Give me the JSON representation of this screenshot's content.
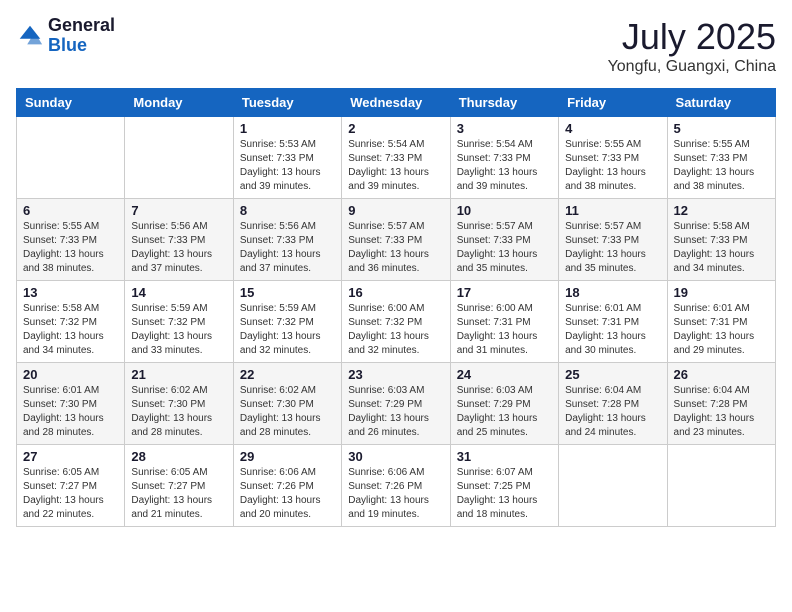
{
  "header": {
    "logo": {
      "general": "General",
      "blue": "Blue"
    },
    "title": "July 2025",
    "location": "Yongfu, Guangxi, China"
  },
  "calendar": {
    "days_of_week": [
      "Sunday",
      "Monday",
      "Tuesday",
      "Wednesday",
      "Thursday",
      "Friday",
      "Saturday"
    ],
    "weeks": [
      [
        {
          "day": "",
          "info": ""
        },
        {
          "day": "",
          "info": ""
        },
        {
          "day": "1",
          "info": "Sunrise: 5:53 AM\nSunset: 7:33 PM\nDaylight: 13 hours and 39 minutes."
        },
        {
          "day": "2",
          "info": "Sunrise: 5:54 AM\nSunset: 7:33 PM\nDaylight: 13 hours and 39 minutes."
        },
        {
          "day": "3",
          "info": "Sunrise: 5:54 AM\nSunset: 7:33 PM\nDaylight: 13 hours and 39 minutes."
        },
        {
          "day": "4",
          "info": "Sunrise: 5:55 AM\nSunset: 7:33 PM\nDaylight: 13 hours and 38 minutes."
        },
        {
          "day": "5",
          "info": "Sunrise: 5:55 AM\nSunset: 7:33 PM\nDaylight: 13 hours and 38 minutes."
        }
      ],
      [
        {
          "day": "6",
          "info": "Sunrise: 5:55 AM\nSunset: 7:33 PM\nDaylight: 13 hours and 38 minutes."
        },
        {
          "day": "7",
          "info": "Sunrise: 5:56 AM\nSunset: 7:33 PM\nDaylight: 13 hours and 37 minutes."
        },
        {
          "day": "8",
          "info": "Sunrise: 5:56 AM\nSunset: 7:33 PM\nDaylight: 13 hours and 37 minutes."
        },
        {
          "day": "9",
          "info": "Sunrise: 5:57 AM\nSunset: 7:33 PM\nDaylight: 13 hours and 36 minutes."
        },
        {
          "day": "10",
          "info": "Sunrise: 5:57 AM\nSunset: 7:33 PM\nDaylight: 13 hours and 35 minutes."
        },
        {
          "day": "11",
          "info": "Sunrise: 5:57 AM\nSunset: 7:33 PM\nDaylight: 13 hours and 35 minutes."
        },
        {
          "day": "12",
          "info": "Sunrise: 5:58 AM\nSunset: 7:33 PM\nDaylight: 13 hours and 34 minutes."
        }
      ],
      [
        {
          "day": "13",
          "info": "Sunrise: 5:58 AM\nSunset: 7:32 PM\nDaylight: 13 hours and 34 minutes."
        },
        {
          "day": "14",
          "info": "Sunrise: 5:59 AM\nSunset: 7:32 PM\nDaylight: 13 hours and 33 minutes."
        },
        {
          "day": "15",
          "info": "Sunrise: 5:59 AM\nSunset: 7:32 PM\nDaylight: 13 hours and 32 minutes."
        },
        {
          "day": "16",
          "info": "Sunrise: 6:00 AM\nSunset: 7:32 PM\nDaylight: 13 hours and 32 minutes."
        },
        {
          "day": "17",
          "info": "Sunrise: 6:00 AM\nSunset: 7:31 PM\nDaylight: 13 hours and 31 minutes."
        },
        {
          "day": "18",
          "info": "Sunrise: 6:01 AM\nSunset: 7:31 PM\nDaylight: 13 hours and 30 minutes."
        },
        {
          "day": "19",
          "info": "Sunrise: 6:01 AM\nSunset: 7:31 PM\nDaylight: 13 hours and 29 minutes."
        }
      ],
      [
        {
          "day": "20",
          "info": "Sunrise: 6:01 AM\nSunset: 7:30 PM\nDaylight: 13 hours and 28 minutes."
        },
        {
          "day": "21",
          "info": "Sunrise: 6:02 AM\nSunset: 7:30 PM\nDaylight: 13 hours and 28 minutes."
        },
        {
          "day": "22",
          "info": "Sunrise: 6:02 AM\nSunset: 7:30 PM\nDaylight: 13 hours and 28 minutes."
        },
        {
          "day": "23",
          "info": "Sunrise: 6:03 AM\nSunset: 7:29 PM\nDaylight: 13 hours and 26 minutes."
        },
        {
          "day": "24",
          "info": "Sunrise: 6:03 AM\nSunset: 7:29 PM\nDaylight: 13 hours and 25 minutes."
        },
        {
          "day": "25",
          "info": "Sunrise: 6:04 AM\nSunset: 7:28 PM\nDaylight: 13 hours and 24 minutes."
        },
        {
          "day": "26",
          "info": "Sunrise: 6:04 AM\nSunset: 7:28 PM\nDaylight: 13 hours and 23 minutes."
        }
      ],
      [
        {
          "day": "27",
          "info": "Sunrise: 6:05 AM\nSunset: 7:27 PM\nDaylight: 13 hours and 22 minutes."
        },
        {
          "day": "28",
          "info": "Sunrise: 6:05 AM\nSunset: 7:27 PM\nDaylight: 13 hours and 21 minutes."
        },
        {
          "day": "29",
          "info": "Sunrise: 6:06 AM\nSunset: 7:26 PM\nDaylight: 13 hours and 20 minutes."
        },
        {
          "day": "30",
          "info": "Sunrise: 6:06 AM\nSunset: 7:26 PM\nDaylight: 13 hours and 19 minutes."
        },
        {
          "day": "31",
          "info": "Sunrise: 6:07 AM\nSunset: 7:25 PM\nDaylight: 13 hours and 18 minutes."
        },
        {
          "day": "",
          "info": ""
        },
        {
          "day": "",
          "info": ""
        }
      ]
    ]
  }
}
